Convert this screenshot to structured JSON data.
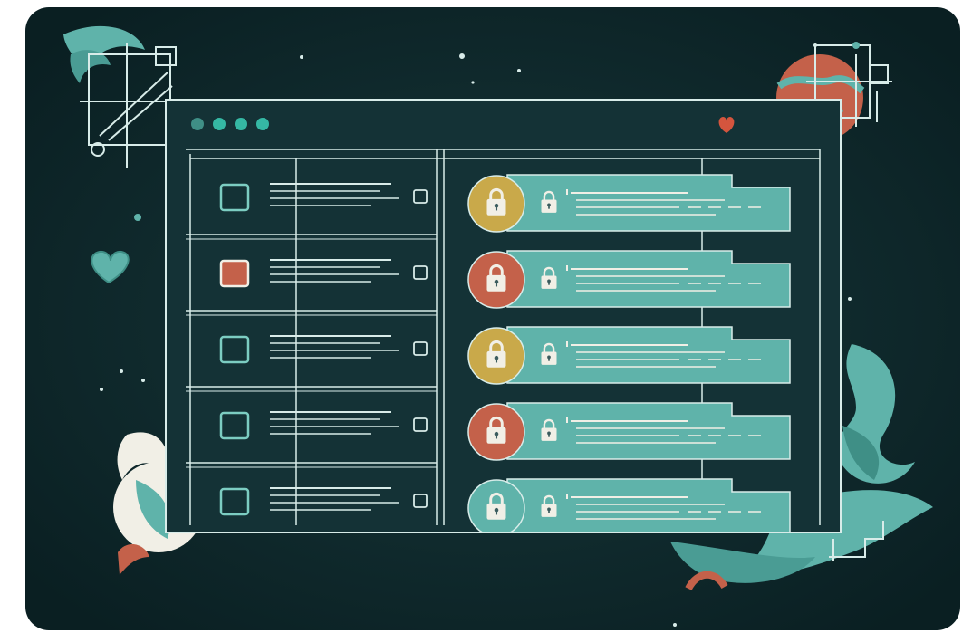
{
  "theme": {
    "backdrop": "#0f2a2d",
    "line": "#d8ece9",
    "teal": "#5fb3aa",
    "teal_light": "#7ccdc2",
    "window_bg": "#143236",
    "gold": "#c9a94a",
    "rust": "#c4614a",
    "red_accent": "#d4553e",
    "cream": "#f1efe6"
  },
  "window": {
    "dots": [
      "#3f8f86",
      "#35b8a4",
      "#35b8a4",
      "#35b8a4"
    ],
    "heart_icon": "heart-icon"
  },
  "checklist": {
    "rows": [
      {
        "checked": false
      },
      {
        "checked": true
      },
      {
        "checked": false
      },
      {
        "checked": false
      },
      {
        "checked": false
      }
    ]
  },
  "lock_rows": [
    {
      "badge_color": "#c9a94a",
      "icon": "lock-icon"
    },
    {
      "badge_color": "#c4614a",
      "icon": "lock-icon"
    },
    {
      "badge_color": "#c9a94a",
      "icon": "lock-icon"
    },
    {
      "badge_color": "#c4614a",
      "icon": "lock-icon"
    },
    {
      "badge_color": "#5fb3aa",
      "icon": "lock-icon"
    }
  ]
}
